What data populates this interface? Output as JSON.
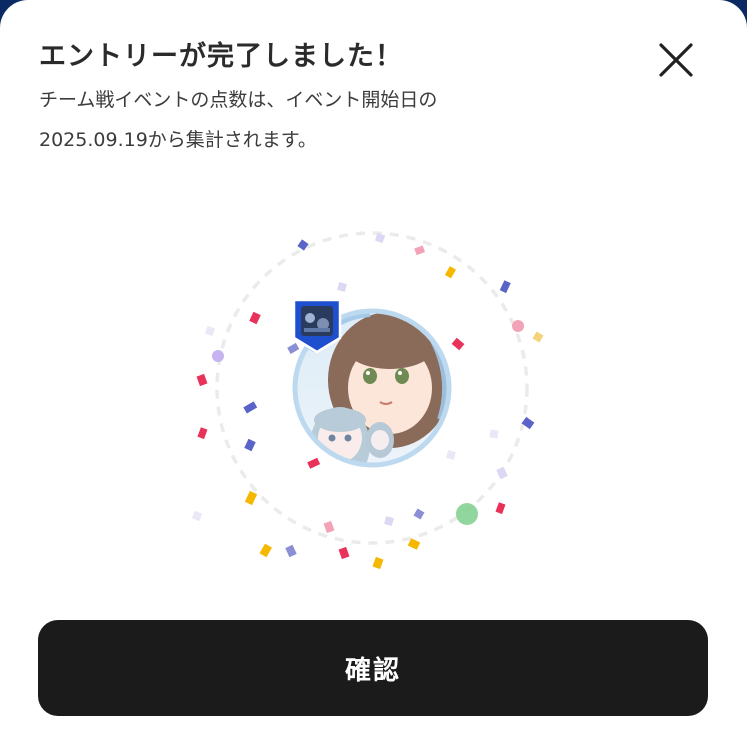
{
  "dialog": {
    "title": "エントリーが完了しました！",
    "description_line1": "チーム戦イベントの点数は、イベント開始日の",
    "description_line2": "2025.09.19から集計されます。",
    "close_icon": "close-icon",
    "confirm_label": "確認"
  },
  "colors": {
    "background": "#0b2a63",
    "sheet": "#ffffff",
    "button": "#1b1b1b",
    "badge": "#1e4fcf",
    "confetti": [
      "#e8325a",
      "#f5b800",
      "#5a64c8",
      "#f3a3b8",
      "#c5b4f0",
      "#7ecf8c",
      "#dad8f2"
    ]
  }
}
